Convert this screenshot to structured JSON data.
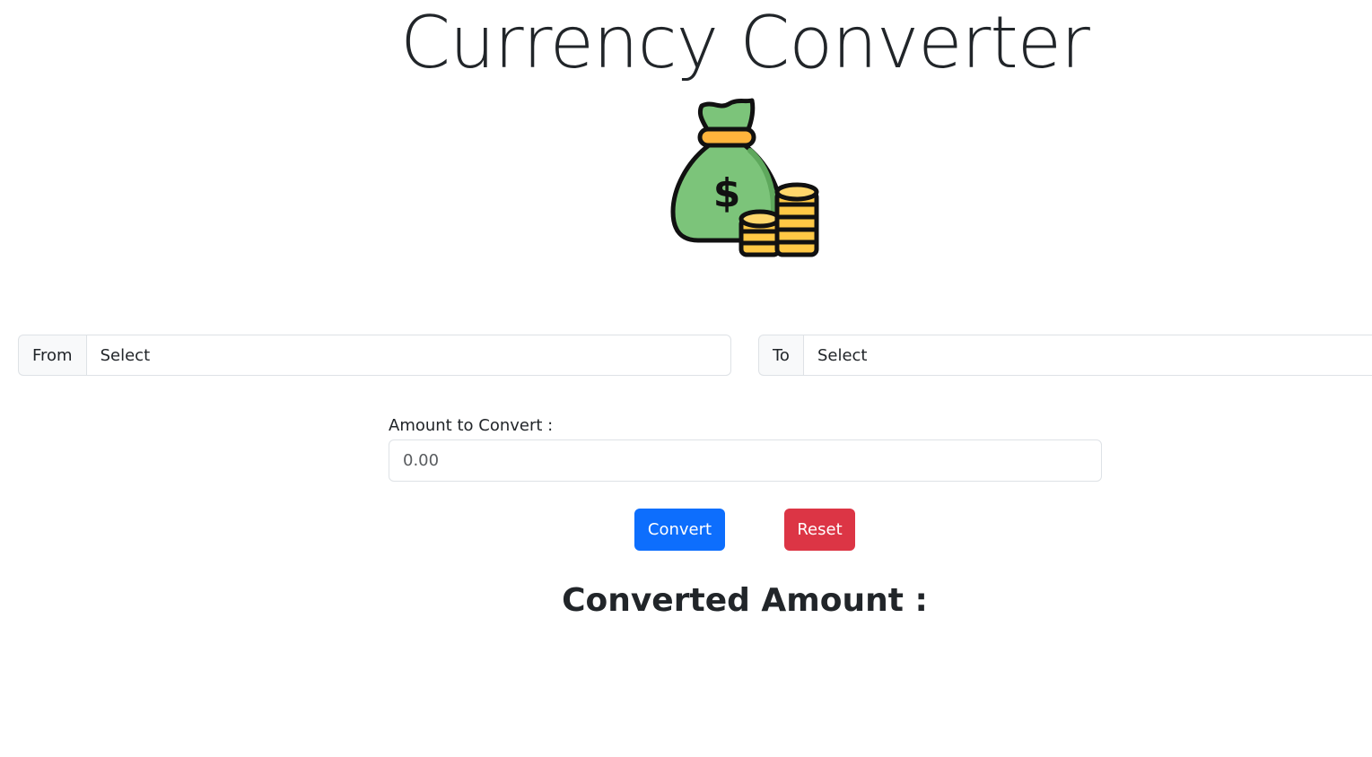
{
  "title": "Currency Converter",
  "logo_icon": "money-bag-with-coins-icon",
  "from": {
    "label": "From",
    "selected": "Select"
  },
  "to": {
    "label": "To",
    "selected": "Select"
  },
  "amount": {
    "label": "Amount to Convert :",
    "placeholder": "0.00",
    "value": ""
  },
  "buttons": {
    "convert": "Convert",
    "reset": "Reset"
  },
  "result": {
    "heading": "Converted Amount :"
  },
  "colors": {
    "primary": "#0d6efd",
    "danger": "#dc3545",
    "text": "#212529",
    "border": "#dee2e6",
    "addon_bg": "#f8f9fa",
    "bag_green": "#7cc47a",
    "coin_gold": "#ffc845"
  }
}
